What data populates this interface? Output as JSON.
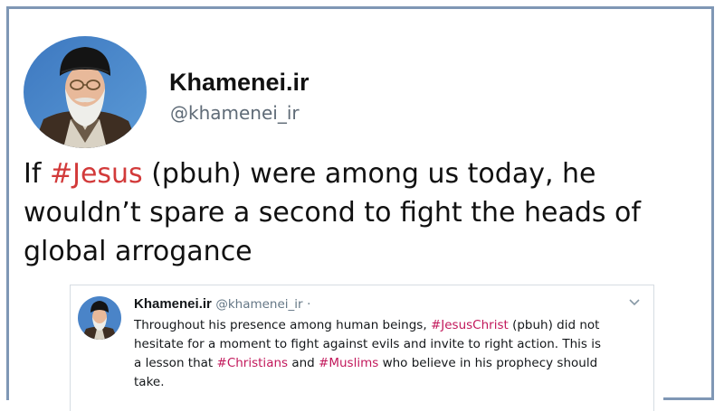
{
  "tweet": {
    "display_name": "Khamenei.ir",
    "handle": "@khamenei_ir",
    "avatar_icon": "profile-photo",
    "text_lines": [
      {
        "before": "If ",
        "hashtag": "#Jesus",
        "after": " (pbuh) were among us today, he"
      },
      {
        "text": "wouldn’t spare a second to fight the heads of"
      },
      {
        "text": "global arrogance"
      }
    ],
    "hashtag_color": "#d23a3a"
  },
  "quoted_tweet": {
    "display_name": "Khamenei.ir",
    "handle": "@khamenei_ir",
    "separator": "·",
    "menu_icon": "chevron-down-icon",
    "lines": [
      {
        "before": "Throughout his presence among human beings, ",
        "hashtag": "#JesusChrist",
        "after": " (pbuh) did not"
      },
      {
        "text": "hesitate for a moment to fight against evils and invite to right action. This is"
      },
      {
        "before": "a lesson that ",
        "hashtag": "#Christians",
        "mid": " and ",
        "hashtag2": "#Muslims",
        "after": " who believe in his prophecy should"
      },
      {
        "text": "take."
      }
    ],
    "hashtag_color": "#c2185b"
  },
  "colors": {
    "frame": "#7f97b5",
    "handle_gray": "#5f6b77"
  }
}
